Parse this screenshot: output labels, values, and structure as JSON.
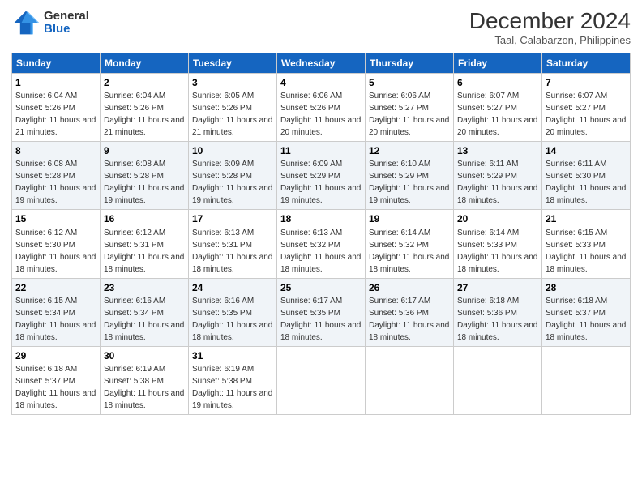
{
  "logo": {
    "general": "General",
    "blue": "Blue"
  },
  "header": {
    "month": "December 2024",
    "location": "Taal, Calabarzon, Philippines"
  },
  "days_of_week": [
    "Sunday",
    "Monday",
    "Tuesday",
    "Wednesday",
    "Thursday",
    "Friday",
    "Saturday"
  ],
  "weeks": [
    [
      {
        "day": "1",
        "sunrise": "6:04 AM",
        "sunset": "5:26 PM",
        "daylight": "11 hours and 21 minutes."
      },
      {
        "day": "2",
        "sunrise": "6:04 AM",
        "sunset": "5:26 PM",
        "daylight": "11 hours and 21 minutes."
      },
      {
        "day": "3",
        "sunrise": "6:05 AM",
        "sunset": "5:26 PM",
        "daylight": "11 hours and 21 minutes."
      },
      {
        "day": "4",
        "sunrise": "6:06 AM",
        "sunset": "5:26 PM",
        "daylight": "11 hours and 20 minutes."
      },
      {
        "day": "5",
        "sunrise": "6:06 AM",
        "sunset": "5:27 PM",
        "daylight": "11 hours and 20 minutes."
      },
      {
        "day": "6",
        "sunrise": "6:07 AM",
        "sunset": "5:27 PM",
        "daylight": "11 hours and 20 minutes."
      },
      {
        "day": "7",
        "sunrise": "6:07 AM",
        "sunset": "5:27 PM",
        "daylight": "11 hours and 20 minutes."
      }
    ],
    [
      {
        "day": "8",
        "sunrise": "6:08 AM",
        "sunset": "5:28 PM",
        "daylight": "11 hours and 19 minutes."
      },
      {
        "day": "9",
        "sunrise": "6:08 AM",
        "sunset": "5:28 PM",
        "daylight": "11 hours and 19 minutes."
      },
      {
        "day": "10",
        "sunrise": "6:09 AM",
        "sunset": "5:28 PM",
        "daylight": "11 hours and 19 minutes."
      },
      {
        "day": "11",
        "sunrise": "6:09 AM",
        "sunset": "5:29 PM",
        "daylight": "11 hours and 19 minutes."
      },
      {
        "day": "12",
        "sunrise": "6:10 AM",
        "sunset": "5:29 PM",
        "daylight": "11 hours and 19 minutes."
      },
      {
        "day": "13",
        "sunrise": "6:11 AM",
        "sunset": "5:29 PM",
        "daylight": "11 hours and 18 minutes."
      },
      {
        "day": "14",
        "sunrise": "6:11 AM",
        "sunset": "5:30 PM",
        "daylight": "11 hours and 18 minutes."
      }
    ],
    [
      {
        "day": "15",
        "sunrise": "6:12 AM",
        "sunset": "5:30 PM",
        "daylight": "11 hours and 18 minutes."
      },
      {
        "day": "16",
        "sunrise": "6:12 AM",
        "sunset": "5:31 PM",
        "daylight": "11 hours and 18 minutes."
      },
      {
        "day": "17",
        "sunrise": "6:13 AM",
        "sunset": "5:31 PM",
        "daylight": "11 hours and 18 minutes."
      },
      {
        "day": "18",
        "sunrise": "6:13 AM",
        "sunset": "5:32 PM",
        "daylight": "11 hours and 18 minutes."
      },
      {
        "day": "19",
        "sunrise": "6:14 AM",
        "sunset": "5:32 PM",
        "daylight": "11 hours and 18 minutes."
      },
      {
        "day": "20",
        "sunrise": "6:14 AM",
        "sunset": "5:33 PM",
        "daylight": "11 hours and 18 minutes."
      },
      {
        "day": "21",
        "sunrise": "6:15 AM",
        "sunset": "5:33 PM",
        "daylight": "11 hours and 18 minutes."
      }
    ],
    [
      {
        "day": "22",
        "sunrise": "6:15 AM",
        "sunset": "5:34 PM",
        "daylight": "11 hours and 18 minutes."
      },
      {
        "day": "23",
        "sunrise": "6:16 AM",
        "sunset": "5:34 PM",
        "daylight": "11 hours and 18 minutes."
      },
      {
        "day": "24",
        "sunrise": "6:16 AM",
        "sunset": "5:35 PM",
        "daylight": "11 hours and 18 minutes."
      },
      {
        "day": "25",
        "sunrise": "6:17 AM",
        "sunset": "5:35 PM",
        "daylight": "11 hours and 18 minutes."
      },
      {
        "day": "26",
        "sunrise": "6:17 AM",
        "sunset": "5:36 PM",
        "daylight": "11 hours and 18 minutes."
      },
      {
        "day": "27",
        "sunrise": "6:18 AM",
        "sunset": "5:36 PM",
        "daylight": "11 hours and 18 minutes."
      },
      {
        "day": "28",
        "sunrise": "6:18 AM",
        "sunset": "5:37 PM",
        "daylight": "11 hours and 18 minutes."
      }
    ],
    [
      {
        "day": "29",
        "sunrise": "6:18 AM",
        "sunset": "5:37 PM",
        "daylight": "11 hours and 18 minutes."
      },
      {
        "day": "30",
        "sunrise": "6:19 AM",
        "sunset": "5:38 PM",
        "daylight": "11 hours and 18 minutes."
      },
      {
        "day": "31",
        "sunrise": "6:19 AM",
        "sunset": "5:38 PM",
        "daylight": "11 hours and 19 minutes."
      },
      null,
      null,
      null,
      null
    ]
  ]
}
